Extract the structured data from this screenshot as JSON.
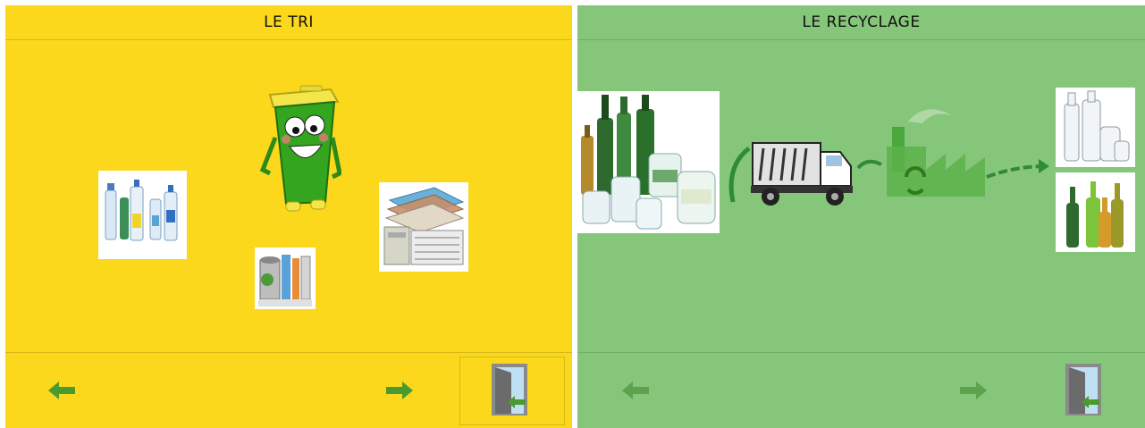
{
  "left_panel": {
    "title": "LE TRI",
    "background": "#fbd81c"
  },
  "right_panel": {
    "title": "LE RECYCLAGE",
    "background": "#85c67a"
  },
  "icons": {
    "arrow_prev": "arrow-left-icon",
    "arrow_next": "arrow-right-icon",
    "exit": "exit-door-icon",
    "arrow_color": "#4a9a2f",
    "arrow_color_faded": "#5fa24e"
  }
}
